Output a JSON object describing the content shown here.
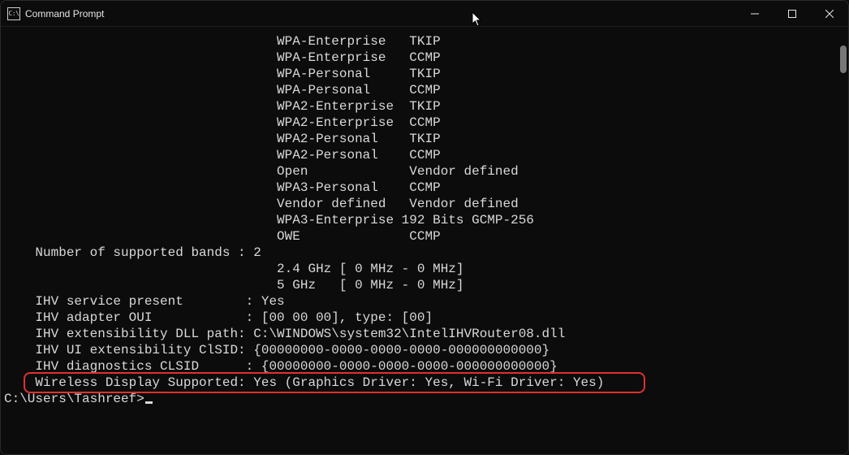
{
  "titlebar": {
    "icon_label": "C:\\",
    "title": "Command Prompt"
  },
  "lines": [
    "                                   WPA-Enterprise   TKIP",
    "                                   WPA-Enterprise   CCMP",
    "                                   WPA-Personal     TKIP",
    "                                   WPA-Personal     CCMP",
    "                                   WPA2-Enterprise  TKIP",
    "                                   WPA2-Enterprise  CCMP",
    "                                   WPA2-Personal    TKIP",
    "                                   WPA2-Personal    CCMP",
    "                                   Open             Vendor defined",
    "                                   WPA3-Personal    CCMP",
    "                                   Vendor defined   Vendor defined",
    "                                   WPA3-Enterprise 192 Bits GCMP-256",
    "                                   OWE              CCMP",
    "    Number of supported bands : 2",
    "                                   2.4 GHz [ 0 MHz - 0 MHz]",
    "                                   5 GHz   [ 0 MHz - 0 MHz]",
    "    IHV service present        : Yes",
    "    IHV adapter OUI            : [00 00 00], type: [00]",
    "    IHV extensibility DLL path: C:\\WINDOWS\\system32\\IntelIHVRouter08.dll",
    "    IHV UI extensibility ClSID: {00000000-0000-0000-0000-000000000000}",
    "    IHV diagnostics CLSID      : {00000000-0000-0000-0000-000000000000}",
    "    Wireless Display Supported: Yes (Graphics Driver: Yes, Wi-Fi Driver: Yes)",
    "",
    "C:\\Users\\Tashreef>"
  ],
  "prompt_index": 23
}
